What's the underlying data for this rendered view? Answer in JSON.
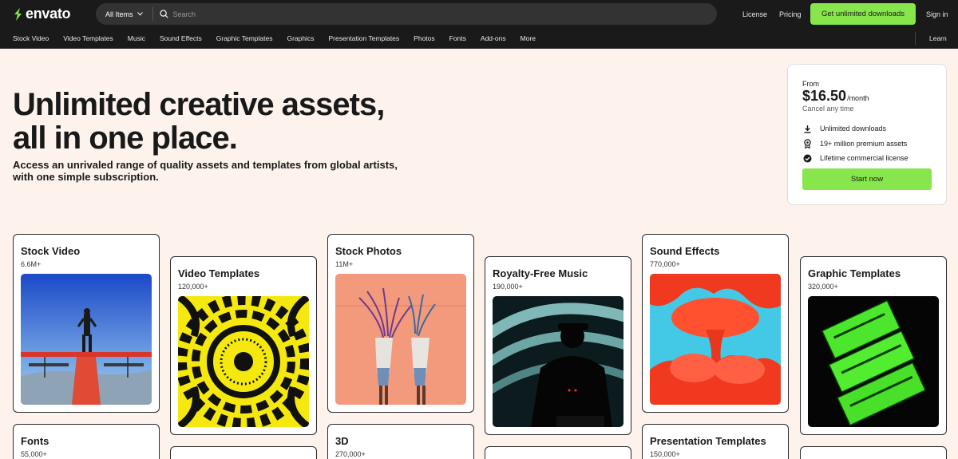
{
  "header": {
    "logo_text": "envato",
    "all_items_label": "All Items",
    "search_placeholder": "Search",
    "license_label": "License",
    "pricing_label": "Pricing",
    "cta_label": "Get unlimited downloads",
    "signin_label": "Sign in"
  },
  "nav": {
    "items": [
      "Stock Video",
      "Video Templates",
      "Music",
      "Sound Effects",
      "Graphic Templates",
      "Graphics",
      "Presentation Templates",
      "Photos",
      "Fonts",
      "Add-ons",
      "More"
    ],
    "learn_label": "Learn"
  },
  "hero": {
    "title_line1": "Unlimited creative assets,",
    "title_line2": "all in one place.",
    "subtitle_line1": "Access an unrivaled range of quality assets and templates from global artists,",
    "subtitle_line2": "with one simple subscription."
  },
  "pricing": {
    "from_label": "From",
    "price": "$16.50",
    "period": "/month",
    "cancel_text": "Cancel any time",
    "features": [
      {
        "icon": "download-icon",
        "text": "Unlimited downloads"
      },
      {
        "icon": "award-icon",
        "text": "19+ million premium assets"
      },
      {
        "icon": "check-badge-icon",
        "text": "Lifetime commercial license"
      }
    ],
    "start_label": "Start now"
  },
  "categories": [
    {
      "title": "Stock Video",
      "count": "6.6M+"
    },
    {
      "title": "Video Templates",
      "count": "120,000+"
    },
    {
      "title": "Stock Photos",
      "count": "11M+"
    },
    {
      "title": "Royalty-Free Music",
      "count": "190,000+"
    },
    {
      "title": "Sound Effects",
      "count": "770,000+"
    },
    {
      "title": "Graphic Templates",
      "count": "320,000+"
    },
    {
      "title": "Fonts",
      "count": "55,000+"
    },
    {
      "title": "",
      "count": ""
    },
    {
      "title": "3D",
      "count": "270,000+"
    },
    {
      "title": "",
      "count": ""
    },
    {
      "title": "Presentation Templates",
      "count": "150,000+"
    },
    {
      "title": "",
      "count": ""
    }
  ],
  "colors": {
    "header_bg": "#1a1a1a",
    "accent_green": "#87e64b",
    "page_bg": "#fdf3ec"
  }
}
